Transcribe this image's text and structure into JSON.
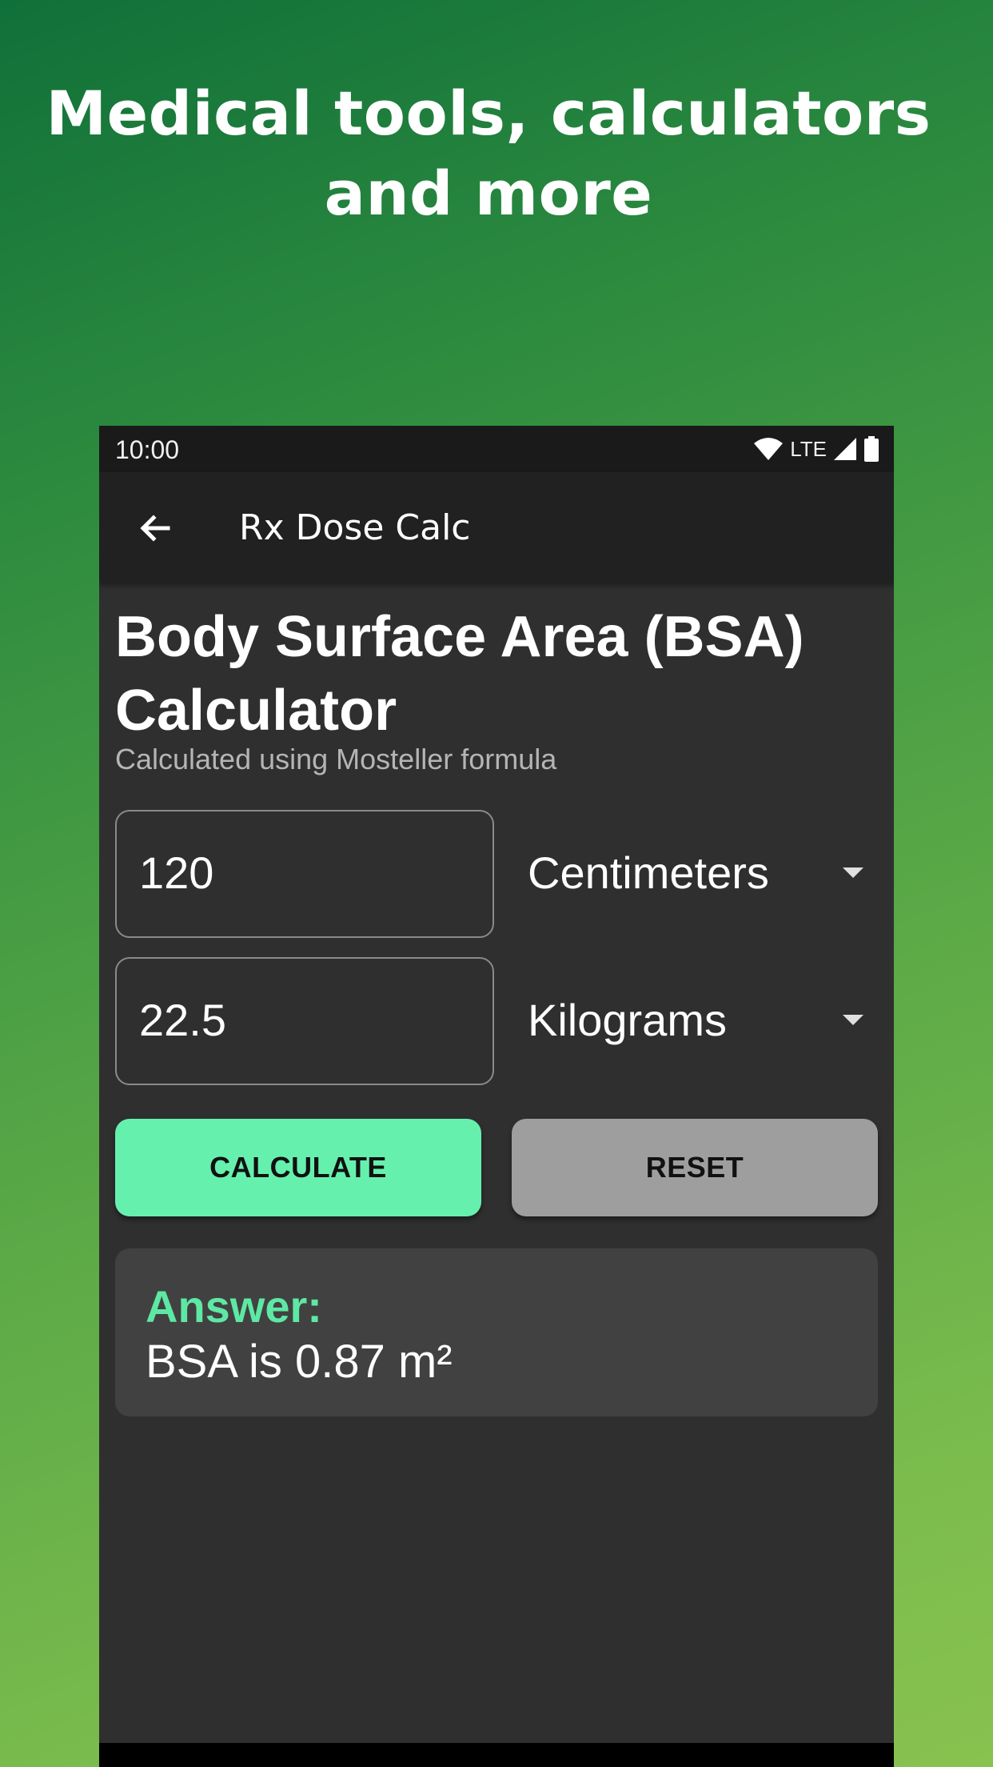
{
  "promo": {
    "line1": "Medical tools, calculators",
    "line2": "and more"
  },
  "status_bar": {
    "time": "10:00",
    "network": "LTE",
    "icons": [
      "wifi-icon",
      "signal-icon",
      "battery-icon"
    ]
  },
  "app_bar": {
    "back_icon": "arrow-back-icon",
    "title": "Rx Dose Calc"
  },
  "calculator": {
    "title": "Body Surface Area (BSA) Calculator",
    "subtitle": "Calculated using Mosteller formula",
    "height_value": "120",
    "height_unit": "Centimeters",
    "weight_value": "22.5",
    "weight_unit": "Kilograms",
    "calculate_label": "CALCULATE",
    "reset_label": "RESET"
  },
  "answer": {
    "label": "Answer:",
    "value": "BSA is 0.87 m²"
  },
  "colors": {
    "accent": "#66f0ae",
    "answer_label": "#5ee8a4",
    "background": "#2f2f2f",
    "reset": "#9e9e9e"
  }
}
